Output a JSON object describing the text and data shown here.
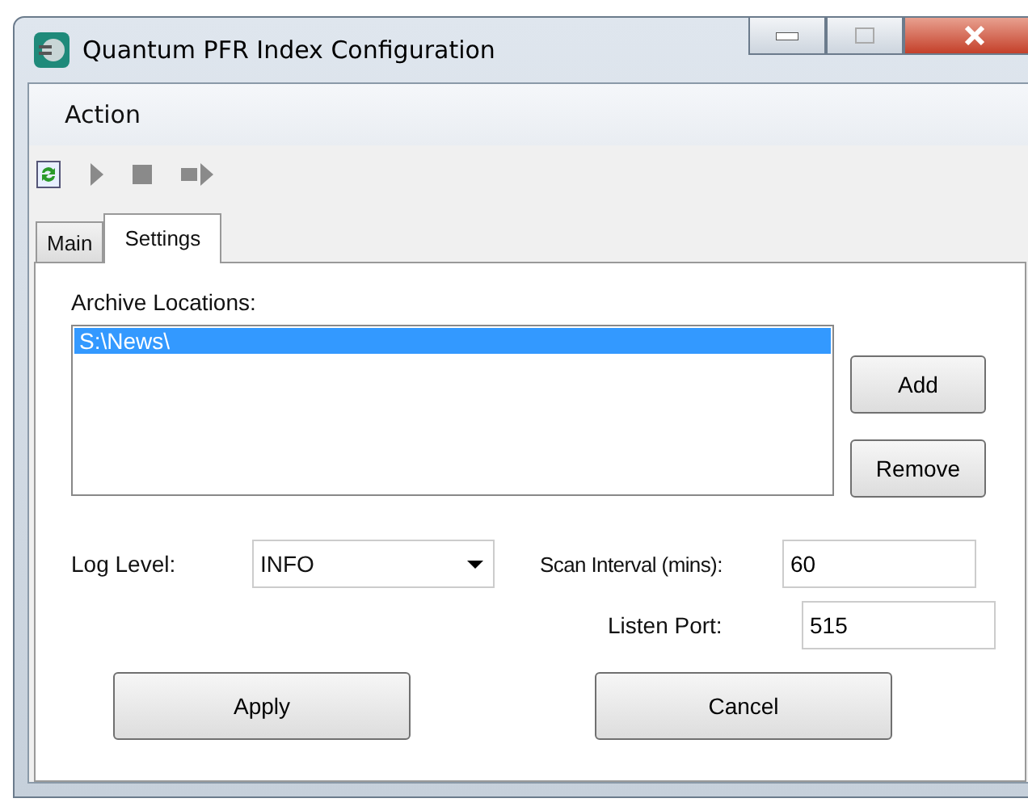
{
  "window": {
    "title": "Quantum PFR Index Configuration"
  },
  "menu": [
    "Action"
  ],
  "toolbar": [
    {
      "kind": "refresh",
      "disabled": false
    },
    {
      "kind": "play",
      "disabled": true
    },
    {
      "kind": "stop",
      "disabled": true
    },
    {
      "kind": "step",
      "disabled": true
    }
  ],
  "tabs": [
    {
      "label": "Main",
      "selected": false
    },
    {
      "label": "Settings",
      "selected": true
    }
  ],
  "archive": {
    "label": "Archive Locations:",
    "items": [
      {
        "text": "S:\\News\\",
        "selected": true
      }
    ],
    "buttons": [
      "Add",
      "Remove"
    ]
  },
  "log_level": {
    "label": "Log Level:",
    "value": "INFO"
  },
  "scan_interval": {
    "label": "Scan Interval (mins):",
    "value": "60"
  },
  "listen_port": {
    "label": "Listen Port:",
    "value": "515"
  },
  "buttons": [
    "Apply",
    "Cancel"
  ]
}
